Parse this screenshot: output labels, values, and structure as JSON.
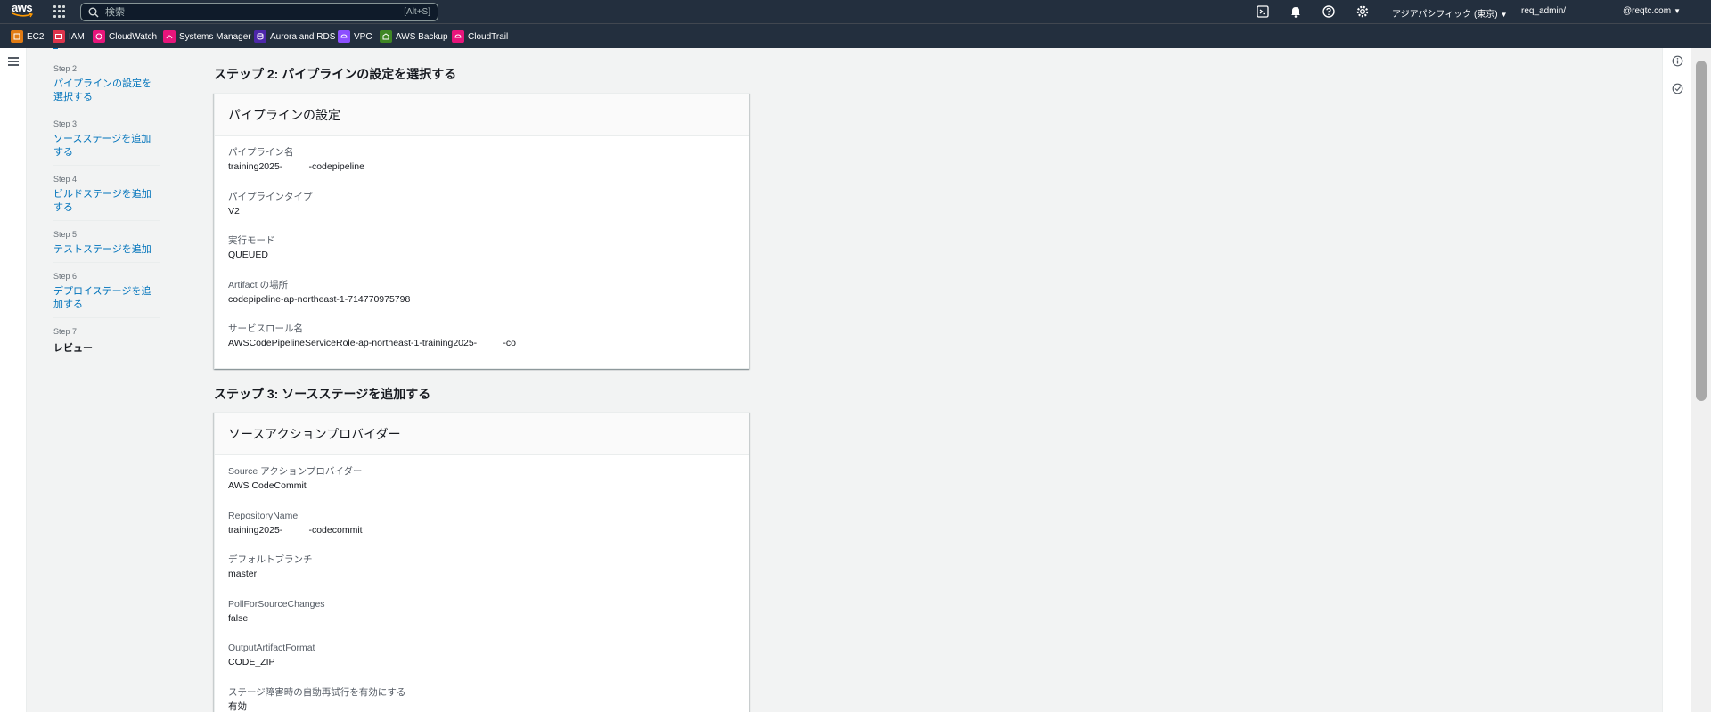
{
  "topnav": {
    "logo_text": "aws",
    "search_placeholder": "検索",
    "search_shortcut": "[Alt+S]",
    "region": "アジアパシフィック (東京)",
    "account": "req_admin/",
    "user": "@reqtc.com"
  },
  "favorites": [
    {
      "label": "EC2",
      "color": "#e07b14",
      "icon": "ec2-icon"
    },
    {
      "label": "IAM",
      "color": "#dd344c",
      "icon": "iam-icon"
    },
    {
      "label": "CloudWatch",
      "color": "#e7157b",
      "icon": "cloudwatch-icon"
    },
    {
      "label": "Systems Manager",
      "color": "#e7157b",
      "icon": "systems-manager-icon"
    },
    {
      "label": "Aurora and RDS",
      "color": "#4d27aa",
      "icon": "rds-icon"
    },
    {
      "label": "VPC",
      "color": "#8c4fff",
      "icon": "vpc-icon"
    },
    {
      "label": "AWS Backup",
      "color": "#3f8624",
      "icon": "backup-icon"
    },
    {
      "label": "CloudTrail",
      "color": "#e7157b",
      "icon": "cloudtrail-icon"
    }
  ],
  "steps": [
    {
      "num": "Step 2",
      "label": "パイプラインの設定を選択する"
    },
    {
      "num": "Step 3",
      "label": "ソースステージを追加する"
    },
    {
      "num": "Step 4",
      "label": "ビルドステージを追加する"
    },
    {
      "num": "Step 5",
      "label": "テストステージを追加"
    },
    {
      "num": "Step 6",
      "label": "デプロイステージを追加する"
    },
    {
      "num": "Step 7",
      "label": "レビュー"
    }
  ],
  "section2": {
    "title": "ステップ 2: パイプラインの設定を選択する",
    "panel_title": "パイプラインの設定",
    "fields": [
      {
        "key": "パイプライン名",
        "value": "training2025-          -codepipeline"
      },
      {
        "key": "パイプラインタイプ",
        "value": "V2"
      },
      {
        "key": "実行モード",
        "value": "QUEUED"
      },
      {
        "key": "Artifact の場所",
        "value": "codepipeline-ap-northeast-1-714770975798"
      },
      {
        "key": "サービスロール名",
        "value": "AWSCodePipelineServiceRole-ap-northeast-1-training2025-          -co"
      }
    ]
  },
  "section3": {
    "title": "ステップ 3: ソースステージを追加する",
    "panel_title": "ソースアクションプロバイダー",
    "fields": [
      {
        "key": "Source アクションプロバイダー",
        "value": "AWS CodeCommit"
      },
      {
        "key": "RepositoryName",
        "value": "training2025-          -codecommit"
      },
      {
        "key": "デフォルトブランチ",
        "value": "master"
      },
      {
        "key": "PollForSourceChanges",
        "value": "false"
      },
      {
        "key": "OutputArtifactFormat",
        "value": "CODE_ZIP"
      },
      {
        "key": "ステージ障害時の自動再試行を有効にする",
        "value": "有効"
      }
    ]
  }
}
